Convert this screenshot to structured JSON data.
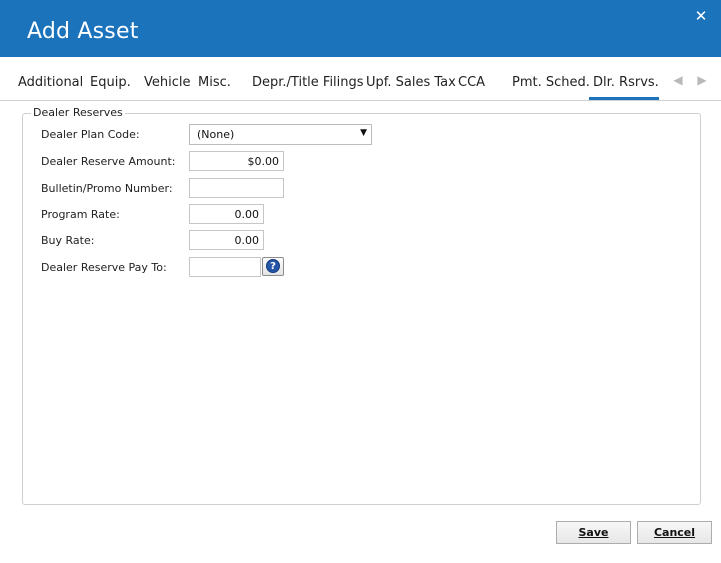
{
  "window": {
    "title": "Add Asset",
    "close_glyph": "✕"
  },
  "tabs": [
    {
      "label": "Additional"
    },
    {
      "label": "Equip."
    },
    {
      "label": "Vehicle"
    },
    {
      "label": "Misc."
    },
    {
      "label": "Depr./Title Filings"
    },
    {
      "label": "Upf. Sales Tax"
    },
    {
      "label": "CCA"
    },
    {
      "label": "Pmt. Sched."
    },
    {
      "label": "Dlr. Rsrvs.",
      "active": true
    }
  ],
  "tab_nav": {
    "prev_glyph": "◀",
    "next_glyph": "▶"
  },
  "group": {
    "legend": "Dealer Reserves",
    "dealer_plan_code": {
      "label": "Dealer Plan Code:",
      "value": "(None)"
    },
    "dealer_reserve_amount": {
      "label": "Dealer Reserve Amount:",
      "value": "$0.00"
    },
    "bulletin_promo_number": {
      "label": "Bulletin/Promo Number:",
      "value": ""
    },
    "program_rate": {
      "label": "Program Rate:",
      "value": "0.00"
    },
    "buy_rate": {
      "label": "Buy Rate:",
      "value": "0.00"
    },
    "dealer_reserve_pay_to": {
      "label": "Dealer Reserve Pay To:",
      "value": "",
      "lookup_glyph": "?"
    }
  },
  "buttons": {
    "save": "Save",
    "cancel": "Cancel"
  },
  "colors": {
    "titlebar": "#1a73bb",
    "active_tab_underline": "#1a73bb"
  },
  "icons": {
    "close": "close-icon",
    "tab_prev": "chevron-left-icon",
    "tab_next": "chevron-right-icon",
    "dropdown": "chevron-down-icon",
    "lookup": "help-question-icon"
  }
}
